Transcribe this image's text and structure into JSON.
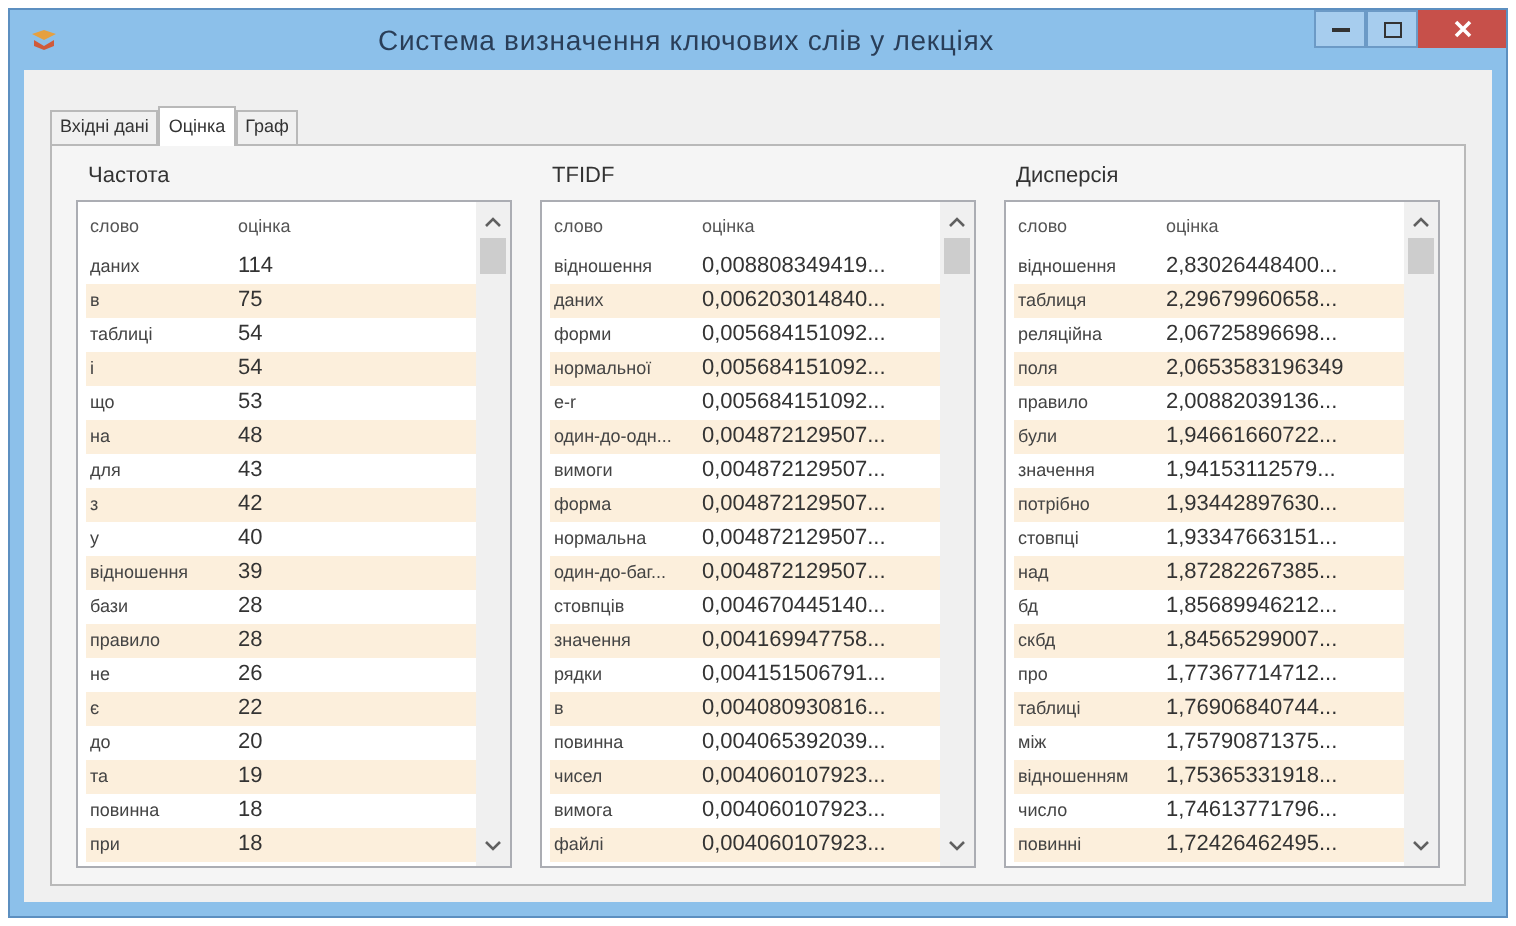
{
  "window": {
    "title": "Система визначення ключових слів у лекціях"
  },
  "tabs": [
    {
      "label": "Вхідні дані",
      "selected": false
    },
    {
      "label": "Оцінка",
      "selected": true
    },
    {
      "label": "Граф",
      "selected": false
    }
  ],
  "panels": [
    {
      "title": "Частота",
      "columns": [
        "слово",
        "оцінка"
      ],
      "rows": [
        [
          "даних",
          "114"
        ],
        [
          "в",
          "75"
        ],
        [
          "таблиці",
          "54"
        ],
        [
          "і",
          "54"
        ],
        [
          "що",
          "53"
        ],
        [
          "на",
          "48"
        ],
        [
          "для",
          "43"
        ],
        [
          "з",
          "42"
        ],
        [
          "у",
          "40"
        ],
        [
          "відношення",
          "39"
        ],
        [
          "бази",
          "28"
        ],
        [
          "правило",
          "28"
        ],
        [
          "не",
          "26"
        ],
        [
          "є",
          "22"
        ],
        [
          "до",
          "20"
        ],
        [
          "та",
          "19"
        ],
        [
          "повинна",
          "18"
        ],
        [
          "при",
          "18"
        ]
      ]
    },
    {
      "title": "TFIDF",
      "columns": [
        "слово",
        "оцінка"
      ],
      "rows": [
        [
          "відношення",
          "0,008808349419..."
        ],
        [
          "даних",
          "0,006203014840..."
        ],
        [
          "форми",
          "0,005684151092..."
        ],
        [
          "нормальної",
          "0,005684151092..."
        ],
        [
          "е-r",
          "0,005684151092..."
        ],
        [
          "один-до-одн...",
          "0,004872129507..."
        ],
        [
          "вимоги",
          "0,004872129507..."
        ],
        [
          "форма",
          "0,004872129507..."
        ],
        [
          "нормальна",
          "0,004872129507..."
        ],
        [
          "один-до-баг...",
          "0,004872129507..."
        ],
        [
          "стовпців",
          "0,004670445140..."
        ],
        [
          "значення",
          "0,004169947758..."
        ],
        [
          "рядки",
          "0,004151506791..."
        ],
        [
          "в",
          "0,004080930816..."
        ],
        [
          "повинна",
          "0,004065392039..."
        ],
        [
          "чисел",
          "0,004060107923..."
        ],
        [
          "вимога",
          "0,004060107923..."
        ],
        [
          "файлі",
          "0,004060107923..."
        ]
      ]
    },
    {
      "title": "Дисперсія",
      "columns": [
        "слово",
        "оцінка"
      ],
      "rows": [
        [
          "відношення",
          "2,83026448400..."
        ],
        [
          "таблиця",
          "2,29679960658..."
        ],
        [
          "реляційна",
          "2,06725896698..."
        ],
        [
          "поля",
          "2,0653583196349"
        ],
        [
          "правило",
          "2,00882039136..."
        ],
        [
          "були",
          "1,94661660722..."
        ],
        [
          "значення",
          "1,94153112579..."
        ],
        [
          "потрібно",
          "1,93442897630..."
        ],
        [
          "стовпці",
          "1,93347663151..."
        ],
        [
          "над",
          "1,87282267385..."
        ],
        [
          "бд",
          "1,85689946212..."
        ],
        [
          "скбд",
          "1,84565299007..."
        ],
        [
          "про",
          "1,77367714712..."
        ],
        [
          "таблиці",
          "1,76906840744..."
        ],
        [
          "між",
          "1,75790871375..."
        ],
        [
          "відношенням",
          "1,75365331918..."
        ],
        [
          "число",
          "1,74613771796..."
        ],
        [
          "повинні",
          "1,72426462495..."
        ]
      ]
    }
  ]
}
